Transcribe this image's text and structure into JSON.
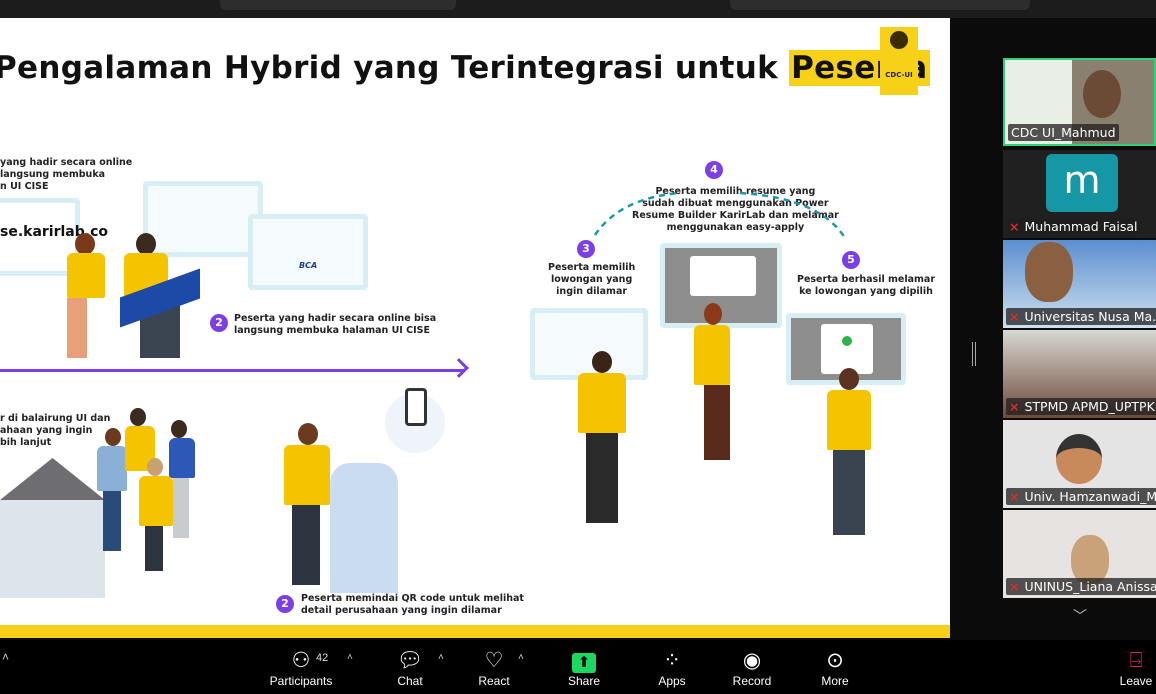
{
  "slide": {
    "title_prefix": "Pengalaman Hybrid yang Terintegrasi untuk ",
    "title_highlight": "Peserta",
    "logo_text": "CDC-UI",
    "online_caption": "yang hadir secara online\nlangsung membuka\nn UI CISE",
    "url_text": "se.karirlab.co",
    "step2_online": "Peserta yang hadir secara online bisa\nlangsung membuka halaman UI CISE",
    "offline_caption": "r di balairung UI dan\nahaan yang ingin\nbih lanjut",
    "step2_offline": "Peserta memindai QR code untuk melihat\ndetail perusahaan yang ingin dilamar",
    "step3": "Peserta memilih\nlowongan yang\ningin dilamar",
    "step4": "Peserta memilih resume yang\nsudah dibuat menggunakan Power\nResume Builder KarirLab dan melamar\nmenggunakan easy-apply",
    "step5": "Peserta berhasil melamar\nke lowongan yang dipilih",
    "num2": "2",
    "num3": "3",
    "num4": "4",
    "num5": "5",
    "bca_label": "BCA",
    "colors": {
      "accent_yellow": "#f7d117",
      "step_purple": "#7b3fe4",
      "arrow_teal": "#1a9aa8"
    }
  },
  "participants": [
    {
      "name": "CDC UI_Mahmud",
      "muted": false,
      "active_speaker": true
    },
    {
      "name": "Muhammad Faisal",
      "muted": true,
      "avatar_letter": "m"
    },
    {
      "name": "Universitas Nusa Ma...",
      "muted": true
    },
    {
      "name": "STPMD APMD_UPTPKP",
      "muted": true
    },
    {
      "name": "Univ. Hamzanwadi_M...",
      "muted": true
    },
    {
      "name": "UNINUS_Liana Anissa",
      "muted": true
    }
  ],
  "toolbar": {
    "participants_label": "Participants",
    "participants_count": "42",
    "chat_label": "Chat",
    "react_label": "React",
    "share_label": "Share",
    "apps_label": "Apps",
    "record_label": "Record",
    "more_label": "More",
    "leave_label": "Leave"
  }
}
